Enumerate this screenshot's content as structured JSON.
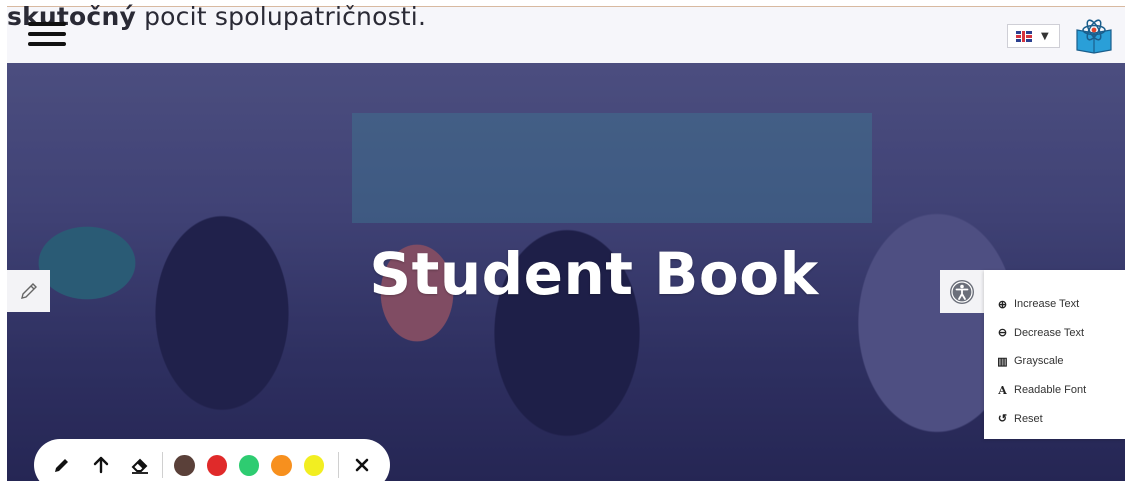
{
  "header": {
    "overflow_text_bold": "skutočný",
    "overflow_text_rest": " pocit spolupatričnosti.",
    "language": {
      "selected": "en-GB",
      "icon": "uk-flag-icon",
      "caret_icon": "caret-down-icon"
    },
    "logo_icon": "atom-book-logo"
  },
  "hero": {
    "title": "Student Book"
  },
  "side_tools": {
    "edit_icon": "pencil-icon",
    "accessibility_icon": "accessibility-icon"
  },
  "accessibility_menu": {
    "items": [
      {
        "label": "Increase Text",
        "icon": "zoom-in-icon"
      },
      {
        "label": "Decrease Text",
        "icon": "zoom-out-icon"
      },
      {
        "label": "Grayscale",
        "icon": "barcode-icon"
      },
      {
        "label": "Readable Font",
        "icon": "font-a-icon"
      },
      {
        "label": "Reset",
        "icon": "reset-icon"
      }
    ]
  },
  "draw_toolbar": {
    "tools": [
      "pencil-icon",
      "arrow-up-icon",
      "eraser-icon"
    ],
    "colors": [
      "#5a4039",
      "#e02a2a",
      "#2ecc71",
      "#f7901e",
      "#f2ee21"
    ],
    "close_icon": "close-icon"
  },
  "colors": {
    "topbar_bg": "#f6f6fa",
    "hero_overlay": "#2b2b6e"
  }
}
